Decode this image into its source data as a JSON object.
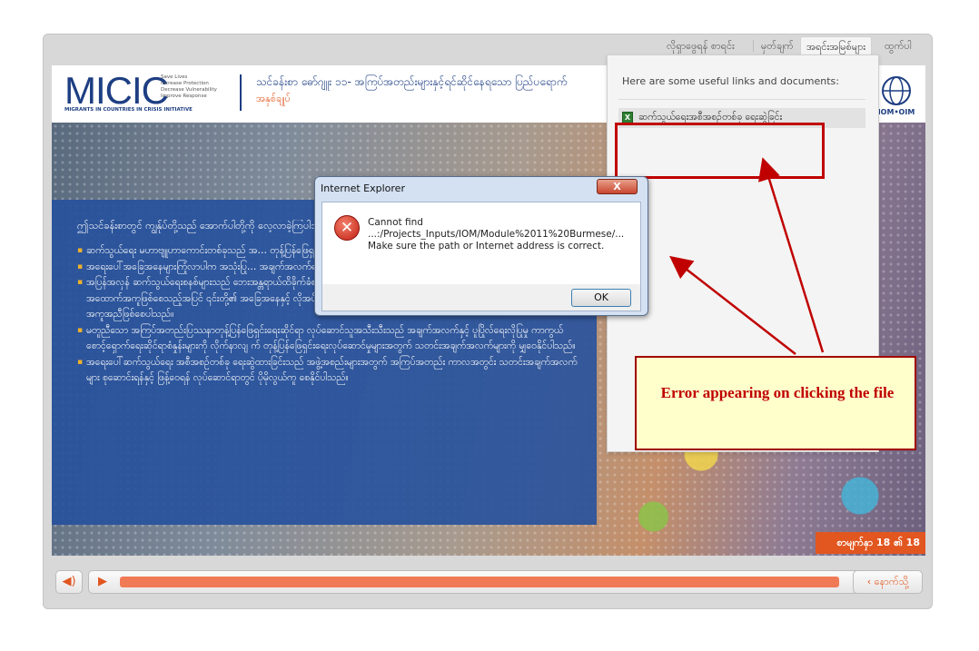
{
  "nav": {
    "glossary": "လိုရှာဖွေရန် စာရင်း",
    "notes": "မှတ်ချက်",
    "resources": "အရင်းအမြစ်များ",
    "exit": "ထွက်ပါ"
  },
  "header": {
    "logo_text": "MICIC",
    "logo_tagline": [
      "Save Lives",
      "Increase Protection",
      "Decrease Vulnerability",
      "Improve Response"
    ],
    "logo_subtitle": "MIGRANTS IN COUNTRIES IN CRISIS INITIATIVE",
    "title": "သင်ခန်းစာ ဓော်ဂျူး ၁၁- အကြပ်အတည်းများနှင့်ရင်ဆိုင်နေရသော ပြည်ပရောက်",
    "subtitle": "အနှစ်ချုပ်",
    "iom_label": "IOM•OIM"
  },
  "content": {
    "intro": "ဤသင်ခန်းစာတွင် ကျွန်ုပ်တို့သည် အောက်ပါတို့ကို လေ့လာခဲ့ကြပါသည်",
    "bullets": [
      "ဆက်သွယ်ရေး မဟာဗျူဟာကောင်းတစ်ခုသည် အ… တုန့်ပြန်ဖြေရှင်းမှုတစ်ရပ်အတွက် အဓိကသော့ချက်…",
      "အရေးပေါ်အခြေအနေများကြုံလာပါက အသုံးပြု… အချက်အလက်ရင်းမြစ်များ နှင့် ဆက်သွယ်ရေး… က် မရှိမဖြစ် လိုအပ်ပါသည်။",
      "အပြန်အလှန် ဆက်သွယ်ရေးစနစ်များသည် ဘေးအန္တရာယ်ထိခိုက်ခံစားရသူများအတွက် သတင်းအချက် အလက်များ ဖြန့်ဝေပေးရာတွင် အထောက်အကူဖြစ်စေသည့်အပြင် ၎င်းတို့၏ အခြေအနေနှင့် လိုအပ်ချက် များနှင့်သက်ဆိုင်သည့် တုန့်ပြန်ချက်များ ရယူနိုင်ရေးအတွက်လည်း အကူအညီဖြစ်စေပါသည်။",
      "မတူညီသော အကြပ်အတည်းပြဿနာတုန့်ပြန်ဖြေရှင်းရေးဆိုင်ရာ လုပ်ဆောင်သူအသီးသီးသည် အချက်အလက်နှင့် ပူပြိုလ်ရေးလိုပြုမှု ကာကွယ်စောင့်ရှောက်ရေးဆိုင်ရာစံနှုန်းများကို လိုက်နာလျ က် တုန့်ပြန်ဖြေရှင်းရေးလုပ်ဆောင်မှုများအတွက် သတင်းအချက်အလက်များကို မျှဝေနိုင်ပါသည်။",
      "အရေးပေါ်ဆက်သွယ်ရေး အစီအစဉ်တစ်ခု ရေးဆွဲထားခြင်းသည် အဖွဲ့အစည်းများအတွက် အကြပ်အတည်း ကာလအတွင်း သတင်းအချက်အလက်များ စုဆောင်းရန်နှင့် ဖြန့်ဝေရန် လုပ်ဆောင်ရာတွင် ပိုမိုလွယ်ကူ စေနိုင်ပါသည်။"
    ],
    "page_indicator": "စာမျက်နှာ 18 ၏ 18"
  },
  "resources": {
    "intro": "Here are some useful links and documents:",
    "item_label": "ဆက်သွယ်ရေးအစီအစဉ်တစ်ခု ရေးဆွဲခြင်း",
    "item_icon": "excel-file-icon"
  },
  "dialog": {
    "title": "Internet Explorer",
    "close_label": "X",
    "line1": "Cannot find",
    "line2": "...:/Projects_Inputs/IOM/Module%2011%20Burmese/...",
    "line3": "Make sure the path or Internet address is correct.",
    "ok_label": "OK"
  },
  "annotation": {
    "text": "Error appearing on clicking the file",
    "color": "#c00000"
  },
  "controls": {
    "prev_label": "‹ နောက်သို့",
    "progress": 0.99
  },
  "colors": {
    "accent": "#e2561f",
    "brand_blue": "#1d3e82",
    "annotation_red": "#c00000"
  }
}
